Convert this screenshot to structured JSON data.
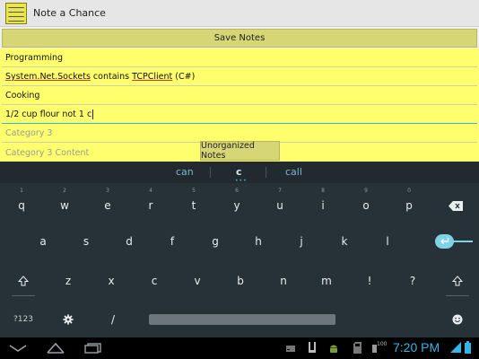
{
  "app": {
    "title": "Note a Chance"
  },
  "toolbar": {
    "save_label": "Save Notes"
  },
  "notes": {
    "category1": "Programming",
    "content1_parts": [
      "System.Net.Sockets",
      " contains ",
      "TCPClient",
      " (C#)"
    ],
    "category2": "Cooking",
    "content2": "1/2 cup flour not 1 c",
    "category3_placeholder": "Category 3",
    "content3_placeholder": "Category 3 Content",
    "unorganized_label": "Unorganized Notes"
  },
  "keyboard": {
    "suggestions": [
      "can",
      "c",
      "call"
    ],
    "row1": [
      {
        "k": "q",
        "h": "1"
      },
      {
        "k": "w",
        "h": "2"
      },
      {
        "k": "e",
        "h": "3"
      },
      {
        "k": "r",
        "h": "4"
      },
      {
        "k": "t",
        "h": "5"
      },
      {
        "k": "y",
        "h": "6"
      },
      {
        "k": "u",
        "h": "7"
      },
      {
        "k": "i",
        "h": "8"
      },
      {
        "k": "o",
        "h": "9"
      },
      {
        "k": "p",
        "h": "0"
      }
    ],
    "row2": [
      "a",
      "s",
      "d",
      "f",
      "g",
      "h",
      "j",
      "k",
      "l"
    ],
    "row3": [
      "z",
      "x",
      "c",
      "v",
      "b",
      "n",
      "m",
      "!",
      "?"
    ],
    "row4": {
      "symbols_label": "?123",
      "slash": "/"
    }
  },
  "status_bar": {
    "time": "7:20 PM",
    "battery_level_text": "100"
  },
  "colors": {
    "note_bg": "#ffff6e",
    "button_bg": "#d6d677",
    "keyboard_bg": "#263238",
    "accent": "#33b5e5"
  }
}
